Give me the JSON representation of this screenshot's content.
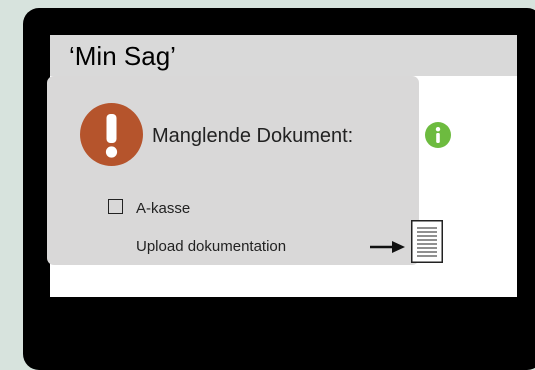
{
  "app": {
    "title": "‘Min Sag’"
  },
  "card": {
    "title": "Manglende Dokument:",
    "checkbox_label": "A-kasse",
    "upload_label": "Upload dokumentation"
  },
  "icons": {
    "alert": "exclamation-icon",
    "info": "info-icon",
    "arrow": "arrow-right-icon",
    "document": "document-icon"
  },
  "colors": {
    "background": "#d7e3dd",
    "device_frame": "#000000",
    "titlebar": "#d9d9d9",
    "card": "#d9d8d8",
    "alert": "#b5542c",
    "info": "#6dbb3f"
  }
}
